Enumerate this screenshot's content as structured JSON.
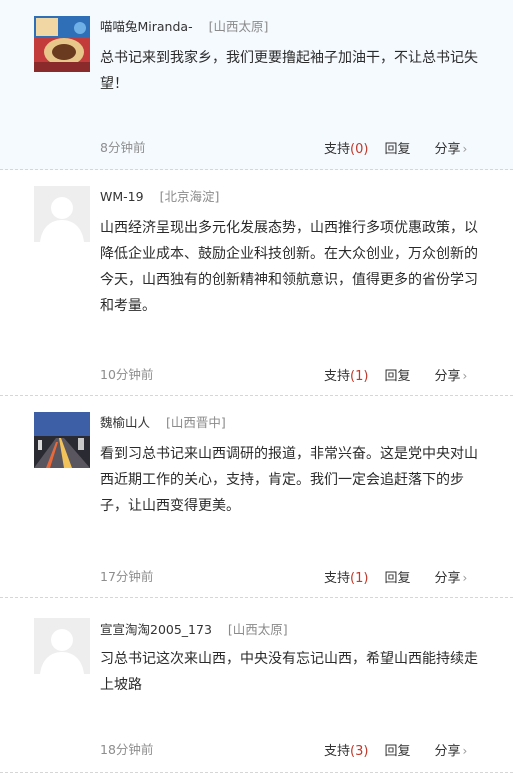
{
  "comments": [
    {
      "username": "喵喵兔Miranda-",
      "location": "[山西太原]",
      "content": "总书记来到我家乡，我们更要撸起袖子加油干，不让总书记失望！",
      "time": "8分钟前",
      "avatar": "photo-avatar",
      "support_count": "(0)"
    },
    {
      "username": "WM-19",
      "location": "[北京海淀]",
      "content": "山西经济呈现出多元化发展态势，山西推行多项优惠政策，以降低企业成本、鼓励企业科技创新。在大众创业，万众创新的今天，山西独有的创新精神和领航意识，值得更多的省份学习和考量。",
      "time": "10分钟前",
      "avatar": "default-avatar",
      "support_count": "(1)"
    },
    {
      "username": "魏榆山人",
      "location": "[山西晋中]",
      "content": "看到习总书记来山西调研的报道，非常兴奋。这是党中央对山西近期工作的关心，支持，肯定。我们一定会追赶落下的步子，让山西变得更美。",
      "time": "17分钟前",
      "avatar": "photo-avatar",
      "support_count": "(1)"
    },
    {
      "username": "宣宣淘淘2005_173",
      "location": "[山西太原]",
      "content": "习总书记这次来山西，中央没有忘记山西，希望山西能持续走上坡路",
      "time": "18分钟前",
      "avatar": "default-avatar",
      "support_count": "(3)"
    }
  ],
  "labels": {
    "support": "支持",
    "reply": "回复",
    "share": "分享",
    "share_chevron": "›"
  },
  "colors": {
    "first_row_bg": "#f5fafe",
    "support_count": "#c0392b",
    "location": "#8a8a8a",
    "divider": "#d6d6d6"
  }
}
